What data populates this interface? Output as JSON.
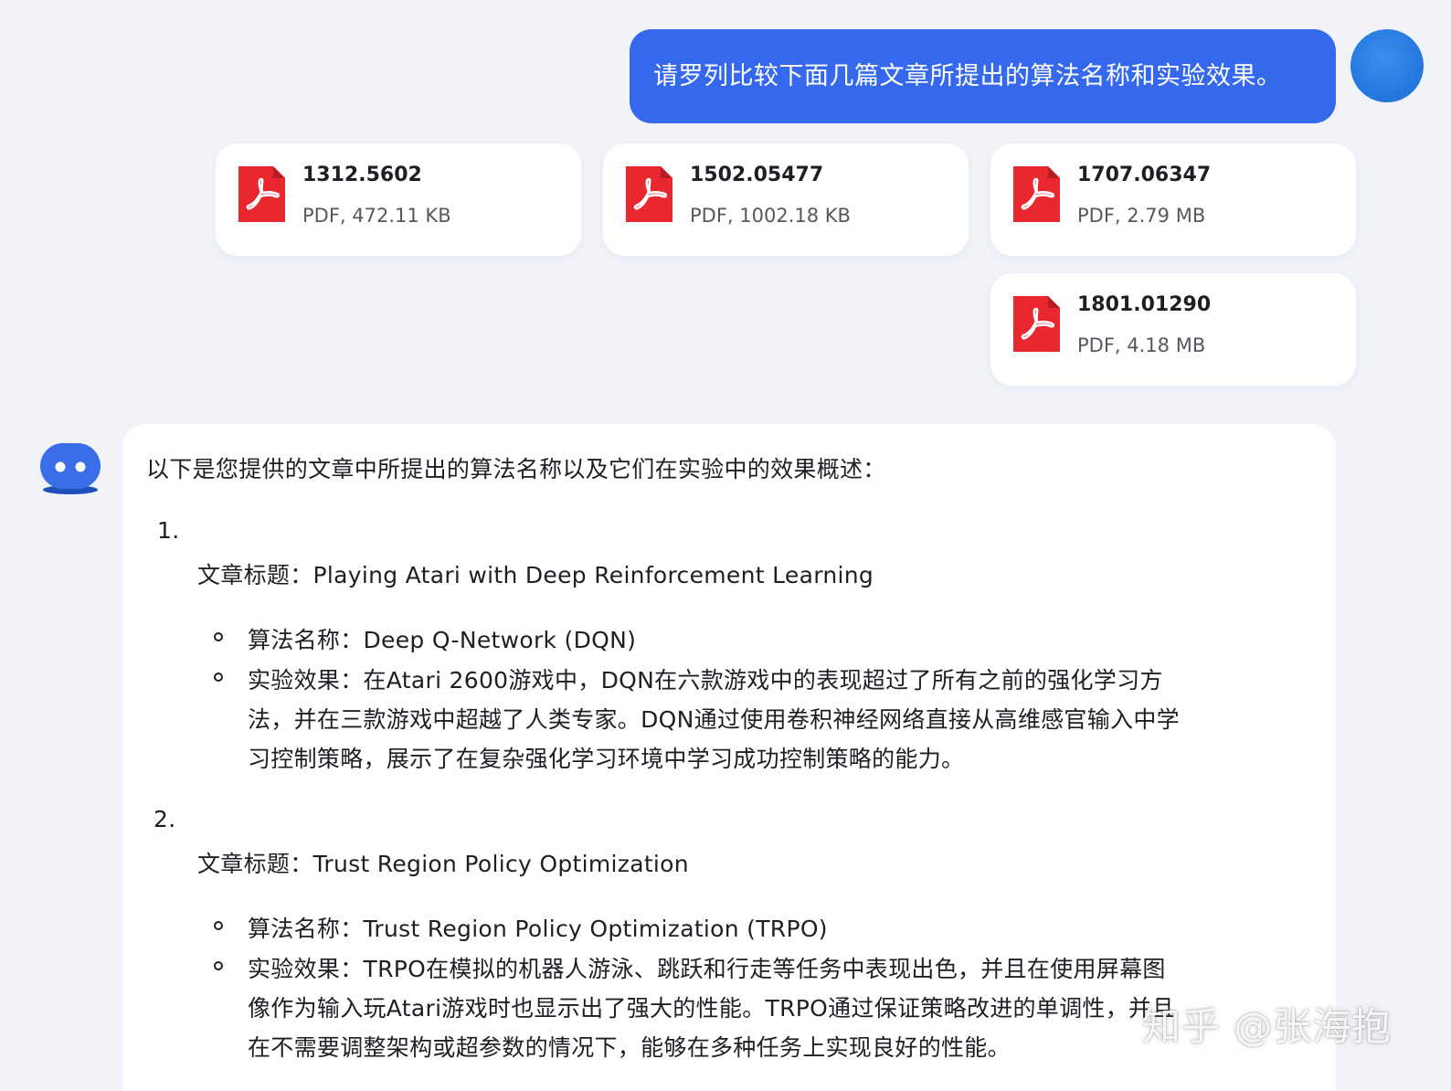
{
  "user_message": {
    "text": "请罗列比较下面几篇文章所提出的算法名称和实验效果。"
  },
  "files": [
    {
      "name": "1312.5602",
      "meta": "PDF, 472.11 KB",
      "icon": "pdf-icon"
    },
    {
      "name": "1502.05477",
      "meta": "PDF, 1002.18 KB",
      "icon": "pdf-icon"
    },
    {
      "name": "1707.06347",
      "meta": "PDF, 2.79 MB",
      "icon": "pdf-icon"
    },
    {
      "name": "1801.01290",
      "meta": "PDF, 4.18 MB",
      "icon": "pdf-icon"
    }
  ],
  "bot_message": {
    "intro": "以下是您提供的文章中所提出的算法名称以及它们在实验中的效果概述：",
    "items": [
      {
        "number": "1.",
        "title": "文章标题：Playing Atari with Deep Reinforcement Learning",
        "algorithm": "算法名称：Deep Q-Network (DQN)",
        "result_lines": [
          "实验效果：在Atari 2600游戏中，DQN在六款游戏中的表现超过了所有之前的强化学习方",
          "法，并在三款游戏中超越了人类专家。DQN通过使用卷积神经网络直接从高维感官输入中学",
          "习控制策略，展示了在复杂强化学习环境中学习成功控制策略的能力。"
        ]
      },
      {
        "number": "2.",
        "title": "文章标题：Trust Region Policy Optimization",
        "algorithm": "算法名称：Trust Region Policy Optimization (TRPO)",
        "result_lines": [
          "实验效果：TRPO在模拟的机器人游泳、跳跃和行走等任务中表现出色，并且在使用屏幕图",
          "像作为输入玩Atari游戏时也显示出了强大的性能。TRPO通过保证策略改进的单调性，并且",
          "在不需要调整架构或超参数的情况下，能够在多种任务上实现良好的性能。"
        ]
      }
    ]
  },
  "watermark": "知乎 @张海抱",
  "colors": {
    "background": "#f1f3f9",
    "user_bubble": "#3568ec",
    "card": "#ffffff",
    "pdf_red": "#e8282e"
  }
}
